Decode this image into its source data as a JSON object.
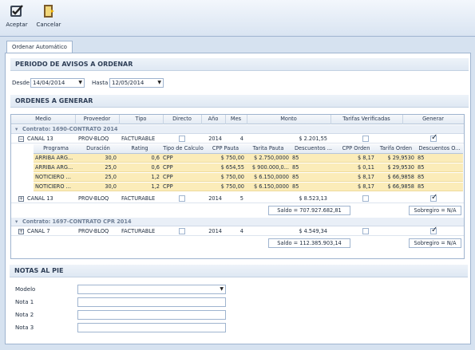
{
  "toolbar": {
    "accept_label": "Aceptar",
    "cancel_label": "Cancelar"
  },
  "tab": {
    "label": "Ordenar Automático"
  },
  "periodo": {
    "title": "PERIODO DE AVISOS A ORDENAR",
    "desde_label": "Desde",
    "desde_value": "14/04/2014",
    "hasta_label": "Hasta",
    "hasta_value": "12/05/2014"
  },
  "ordenes": {
    "title": "ORDENES A GENERAR",
    "columns": [
      "Medio",
      "Proveedor",
      "Tipo",
      "Directo",
      "Año",
      "Mes",
      "Monto",
      "Tarifas Verificadas",
      "Generar"
    ],
    "groups": [
      {
        "label": "Contrato: 1690-CONTRATO 2014",
        "rows": [
          {
            "medio": "CANAL 13",
            "proveedor": "PROV-BLOQ",
            "tipo": "FACTURABLE",
            "anio": "2014",
            "mes": "4",
            "monto": "$ 2.201,55",
            "generar": true,
            "expanded": true
          },
          {
            "medio": "CANAL 13",
            "proveedor": "PROV-BLOQ",
            "tipo": "FACTURABLE",
            "anio": "2014",
            "mes": "5",
            "monto": "$ 8.523,13",
            "generar": true,
            "expanded": false
          }
        ],
        "saldo": "Saldo = 707.927.682,81",
        "sobregiro": "Sobregiro = N/A"
      },
      {
        "label": "Contrato: 1697-CONTRATO CPR 2014",
        "rows": [
          {
            "medio": "CANAL 7",
            "proveedor": "PROV-BLOQ",
            "tipo": "FACTURABLE",
            "anio": "2014",
            "mes": "4",
            "monto": "$ 4.549,34",
            "generar": true,
            "expanded": false
          }
        ],
        "saldo": "Saldo = 112.385.903,14",
        "sobregiro": "Sobregiro = N/A"
      }
    ],
    "detail_columns": [
      "Programa",
      "Duración",
      "Rating",
      "Tipo de Calculo",
      "CPP Pauta",
      "Tarita Pauta",
      "Descuentos ...",
      "CPP Orden",
      "Tarifa Orden",
      "Descuentos O..."
    ],
    "detail_rows": [
      [
        "ARRIBA ARG...",
        "30,0",
        "0,6",
        "CPP",
        "$ 750,00",
        "$ 2.750,0000",
        "85",
        "$ 8,17",
        "$ 29,9530",
        "85"
      ],
      [
        "ARRIBA ARG...",
        "25,0",
        "0,6",
        "CPP",
        "$ 654,55",
        "$ 900.000,0...",
        "85",
        "$ 0,11",
        "$ 29,9530",
        "85"
      ],
      [
        "NOTICIERO ...",
        "25,0",
        "1,2",
        "CPP",
        "$ 750,00",
        "$ 6.150,0000",
        "85",
        "$ 8,17",
        "$ 66,9858",
        "85"
      ],
      [
        "NOTICIERO ...",
        "30,0",
        "1,2",
        "CPP",
        "$ 750,00",
        "$ 6.150,0000",
        "85",
        "$ 8,17",
        "$ 66,9858",
        "85"
      ]
    ]
  },
  "notas": {
    "title": "NOTAS AL PIE",
    "modelo_label": "Modelo",
    "nota1_label": "Nota 1",
    "nota2_label": "Nota 2",
    "nota3_label": "Nota 3"
  },
  "colors": {
    "accent": "#9fb4cf",
    "highlight_row": "#fbecb9",
    "group_row": "#e9eff7"
  }
}
